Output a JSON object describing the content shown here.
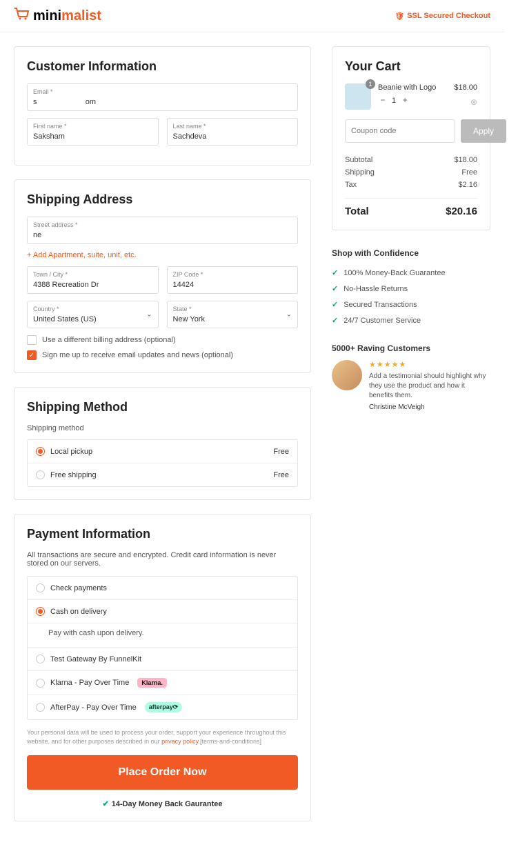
{
  "header": {
    "brand_a": "mini",
    "brand_b": "malist",
    "ssl": "SSL Secured Checkout"
  },
  "customer": {
    "title": "Customer Information",
    "email_label": "Email *",
    "email_value": "s                       om",
    "first_label": "First name *",
    "first_value": "Saksham",
    "last_label": "Last name *",
    "last_value": "Sachdeva"
  },
  "shipping": {
    "title": "Shipping Address",
    "street_label": "Street address *",
    "street_value": "ne",
    "add_apt": "+ Add Apartment, suite, unit, etc.",
    "city_label": "Town / City *",
    "city_value": "4388 Recreation Dr",
    "zip_label": "ZIP Code *",
    "zip_value": "14424",
    "country_label": "Country *",
    "country_value": "United States (US)",
    "state_label": "State *",
    "state_value": "New York",
    "diff_billing": "Use a different billing address (optional)",
    "signup": "Sign me up to receive email updates and news (optional)"
  },
  "method": {
    "title": "Shipping Method",
    "sub": "Shipping method",
    "opt1": "Local pickup",
    "opt1_price": "Free",
    "opt2": "Free shipping",
    "opt2_price": "Free"
  },
  "payment": {
    "title": "Payment Information",
    "desc": "All transactions are secure and encrypted. Credit card information is never stored on our servers.",
    "opt1": "Check payments",
    "opt2": "Cash on delivery",
    "cod_note": "Pay with cash upon delivery.",
    "opt3": "Test Gateway By FunnelKit",
    "opt4": "Klarna - Pay Over Time",
    "klarna_pill": "Klarna.",
    "opt5": "AfterPay - Pay Over Time",
    "afterpay_pill": "afterpay⟳",
    "disclaimer_a": "Your personal data will be used to process your order, support your experience throughout this website, and for other purposes described in our ",
    "privacy": "privacy policy",
    "disclaimer_b": ".[terms-and-conditions]",
    "place": "Place Order Now",
    "guarantee": "14-Day Money Back Gaurantee"
  },
  "cart": {
    "title": "Your Cart",
    "item_name": "Beanie with Logo",
    "item_price": "$18.00",
    "qty": "1",
    "badge": "1",
    "coupon_ph": "Coupon code",
    "apply": "Apply",
    "subtotal_l": "Subtotal",
    "subtotal_v": "$18.00",
    "shipping_l": "Shipping",
    "shipping_v": "Free",
    "tax_l": "Tax",
    "tax_v": "$2.16",
    "total_l": "Total",
    "total_v": "$20.16"
  },
  "confidence": {
    "title": "Shop with Confidence",
    "i1": "100% Money-Back Guarantee",
    "i2": "No-Hassle Returns",
    "i3": "Secured Transactions",
    "i4": "24/7 Customer Service"
  },
  "raving": {
    "title": "5000+ Raving Customers",
    "text": "Add a testimonial should highlight why they use the product and how it benefits them.",
    "author": "Christine McVeigh"
  }
}
